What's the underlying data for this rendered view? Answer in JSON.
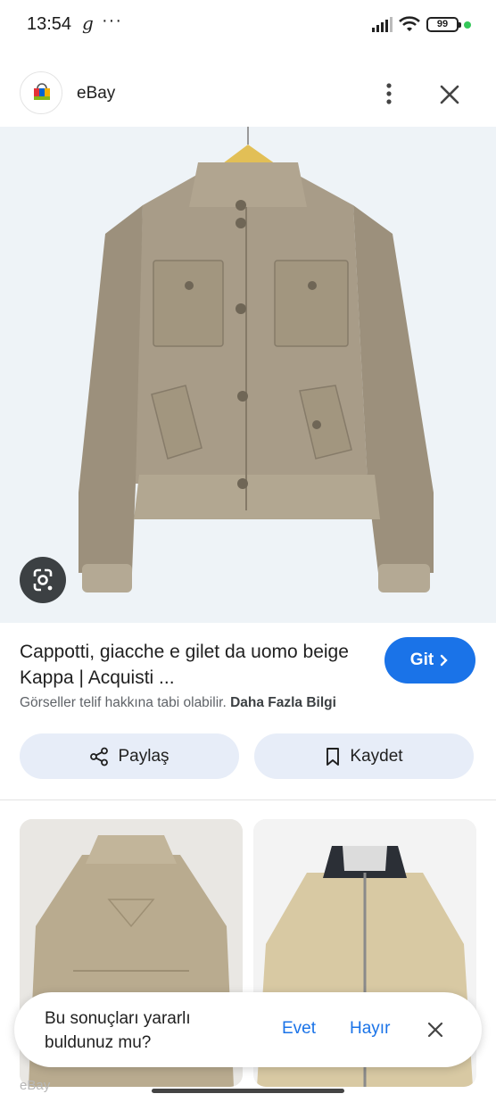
{
  "status_bar": {
    "time": "13:54",
    "g_icon": "g-logo-icon",
    "dots": "···",
    "battery": "99",
    "icons": [
      "signal-icon",
      "wifi-icon",
      "battery-icon"
    ]
  },
  "header": {
    "site_name": "eBay",
    "favicon": "ebay-bag-icon",
    "more_icon": "more-vert-icon",
    "close_icon": "close-icon"
  },
  "result": {
    "title": "Cappotti, giacche e gilet da uomo beige Kappa | Acquisti ...",
    "visit_label": "Git",
    "copyright_text": "Görseller telif hakkına tabi olabilir.",
    "more_info": "Daha Fazla Bilgi"
  },
  "actions": {
    "share_label": "Paylaş",
    "save_label": "Kaydet"
  },
  "related": {
    "source": "eBay"
  },
  "feedback": {
    "question": "Bu sonuçları yararlı buldunuz mu?",
    "yes": "Evet",
    "no": "Hayır"
  },
  "colors": {
    "accent": "#1a73e8",
    "button_bg": "#e7edf8",
    "jacket": "#a89c88"
  }
}
